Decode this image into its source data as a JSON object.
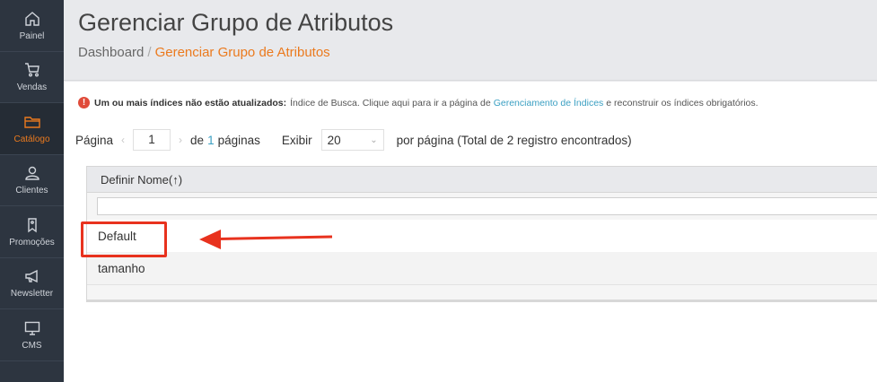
{
  "sidebar": {
    "items": [
      {
        "label": "Painel",
        "icon": "home-icon",
        "active": false
      },
      {
        "label": "Vendas",
        "icon": "cart-icon",
        "active": false
      },
      {
        "label": "Catálogo",
        "icon": "folder-icon",
        "active": true
      },
      {
        "label": "Clientes",
        "icon": "user-icon",
        "active": false
      },
      {
        "label": "Promoções",
        "icon": "tag-icon",
        "active": false
      },
      {
        "label": "Newsletter",
        "icon": "megaphone-icon",
        "active": false
      },
      {
        "label": "CMS",
        "icon": "monitor-icon",
        "active": false
      }
    ],
    "active_color": "#eb7a1e"
  },
  "header": {
    "title": "Gerenciar Grupo de Atributos",
    "breadcrumb": {
      "root": "Dashboard",
      "separator": "/",
      "current": "Gerenciar Grupo de Atributos"
    }
  },
  "alert": {
    "bold": "Um ou mais índices não estão atualizados:",
    "text_before": "Índice de Busca. Clique aqui para ir a página de",
    "link": "Gerenciamento de Índices",
    "text_after": "e reconstruir os índices obrigatórios."
  },
  "pager": {
    "page_label": "Página",
    "prev": "‹",
    "current_page": "1",
    "next": "›",
    "of_label": "de",
    "total_pages": "1",
    "pages_label": "páginas",
    "show_label": "Exibir",
    "per_page": "20",
    "per_page_label": "por página (Total de",
    "total_records": "2",
    "records_label": "registro encontrados)"
  },
  "grid": {
    "column_header": "Definir Nome",
    "sort_indicator": "(↑)",
    "filter_value": "",
    "rows": [
      "Default",
      "tamanho"
    ]
  },
  "annotation": {
    "color": "#e8321e",
    "target": "Default"
  }
}
